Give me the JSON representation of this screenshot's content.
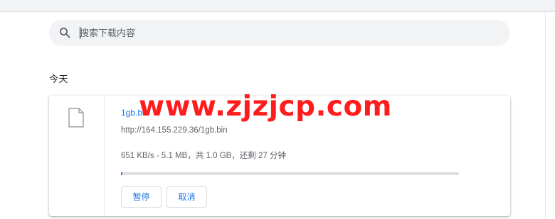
{
  "search": {
    "placeholder": "搜索下载内容",
    "icon": "search-icon"
  },
  "section": {
    "heading": "今天"
  },
  "download": {
    "file_name": "1gb.bin",
    "url": "http://164.155.229.36/1gb.bin",
    "status": "651 KB/s - 5.1 MB，共 1.0 GB，还剩 27 分钟",
    "progress_fraction": 0.005,
    "icon": "file-icon",
    "pause_label": "暂停",
    "cancel_label": "取消"
  },
  "watermark": {
    "text": "www.zjzjcp.com"
  },
  "colors": {
    "accent": "#1a73e8",
    "watermark": "#ff1c1c",
    "background": "#ffffff",
    "search_bg": "#f1f3f4"
  }
}
